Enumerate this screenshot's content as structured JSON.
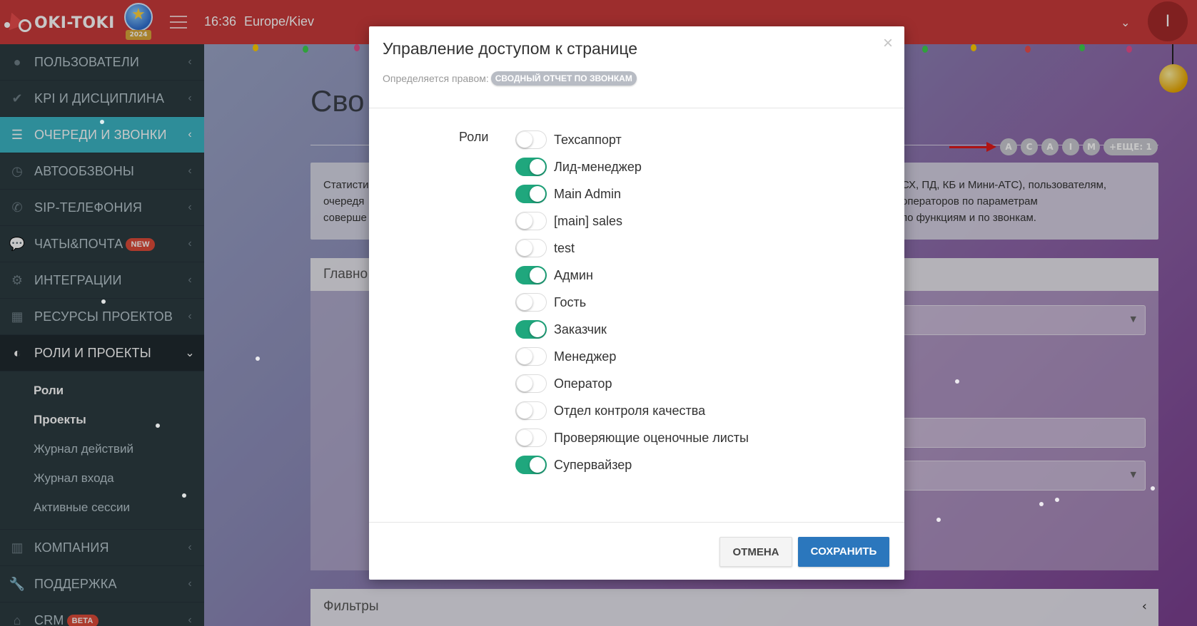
{
  "topbar": {
    "logo_text": "OKI-TOKI",
    "badge_year": "2024",
    "clock": "16:36",
    "timezone": "Europe/Kiev",
    "avatar_letter": "I",
    "accent_color": "#c93a3a"
  },
  "sidebar": {
    "items": [
      {
        "label": "ПОЛЬЗОВАТЕЛИ",
        "icon": "user-icon"
      },
      {
        "label": "KPI И ДИСЦИПЛИНА",
        "icon": "check-icon"
      },
      {
        "label": "ОЧЕРЕДИ И ЗВОНКИ",
        "icon": "list-icon",
        "active": true
      },
      {
        "label": "АВТООБЗВОНЫ",
        "icon": "history-icon"
      },
      {
        "label": "SIP-ТЕЛЕФОНИЯ",
        "icon": "phone-icon"
      },
      {
        "label": "ЧАТЫ&ПОЧТА",
        "icon": "chat-icon",
        "tag": "NEW"
      },
      {
        "label": "ИНТЕГРАЦИИ",
        "icon": "cogs-icon"
      },
      {
        "label": "РЕСУРСЫ ПРОЕКТОВ",
        "icon": "grid-icon"
      },
      {
        "label": "РОЛИ И ПРОЕКТЫ",
        "icon": "toggle-icon",
        "open": true
      }
    ],
    "submenu": [
      "Роли",
      "Проекты",
      "Журнал действий",
      "Журнал входа",
      "Активные сессии"
    ],
    "bottom_items": [
      {
        "label": "КОМПАНИЯ",
        "icon": "bar-chart-icon"
      },
      {
        "label": "ПОДДЕРЖКА",
        "icon": "wrench-icon"
      },
      {
        "label": "CRM",
        "icon": "crm-icon",
        "tag": "BETA"
      }
    ]
  },
  "background": {
    "page_title": "Сво",
    "info_left": [
      "Статисти",
      "очередя",
      "соверше"
    ],
    "info_right": [
      "СХ, ПД, КБ и Мини-АТС), пользователям,",
      "операторов по параметрам",
      "по функциям и по звонкам."
    ],
    "panel_title": "Главно",
    "filters_title": "Фильтры",
    "access_pills": [
      "А",
      "С",
      "А",
      "I",
      "М"
    ],
    "access_more": "+ЕЩЕ: 1"
  },
  "modal": {
    "title": "Управление доступом к странице",
    "subtitle_prefix": "Определяется правом:",
    "right_name": "СВОДНЫЙ ОТЧЕТ ПО ЗВОНКАМ",
    "roles_label": "Роли",
    "roles": [
      {
        "name": "Техсаппорт",
        "enabled": false
      },
      {
        "name": "Лид-менеджер",
        "enabled": true
      },
      {
        "name": "Main Admin",
        "enabled": true
      },
      {
        "name": "[main] sales",
        "enabled": false
      },
      {
        "name": "test",
        "enabled": false
      },
      {
        "name": "Админ",
        "enabled": true
      },
      {
        "name": "Гость",
        "enabled": false
      },
      {
        "name": "Заказчик",
        "enabled": true
      },
      {
        "name": "Менеджер",
        "enabled": false
      },
      {
        "name": "Оператор",
        "enabled": false
      },
      {
        "name": "Отдел контроля качества",
        "enabled": false
      },
      {
        "name": "Проверяющие оценочные листы",
        "enabled": false
      },
      {
        "name": "Супервайзер",
        "enabled": true
      }
    ],
    "cancel_label": "ОТМЕНА",
    "save_label": "СОХРАНИТЬ",
    "toggle_on_color": "#1fa77d",
    "save_color": "#2b77bd"
  }
}
